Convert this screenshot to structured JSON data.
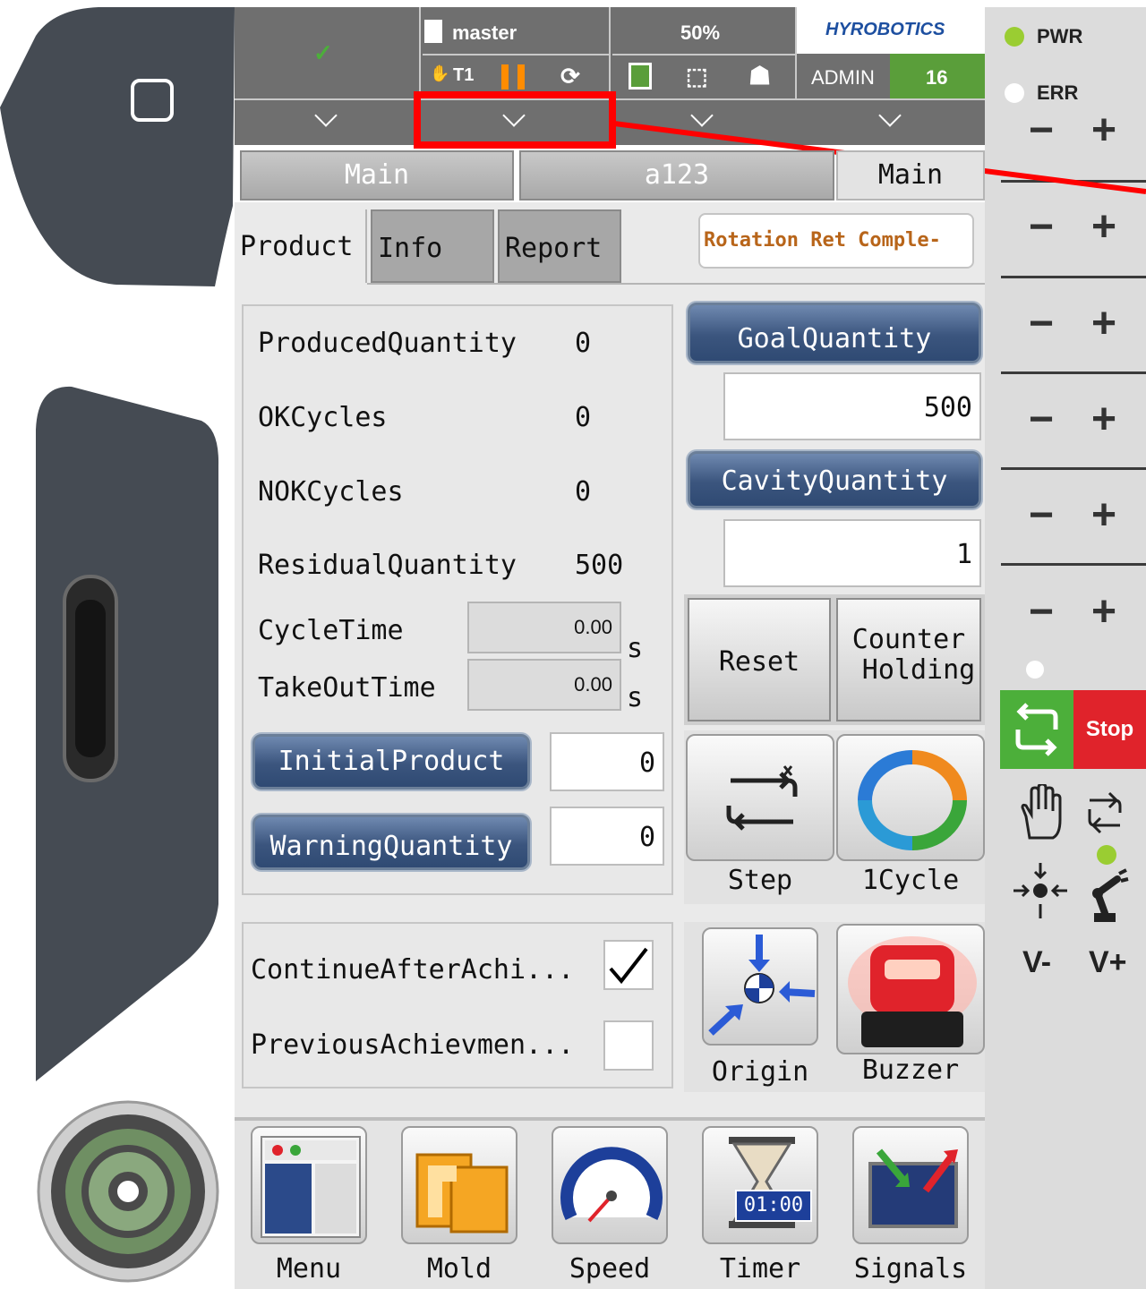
{
  "status_bar": {
    "check_symbol": "✓",
    "program_name": "master",
    "mode": "T1",
    "speed": "50%",
    "brand_logo": "HYROBOTICS",
    "user": "ADMIN",
    "user_level": "16"
  },
  "side_panel": {
    "pwr_label": "PWR",
    "err_label": "ERR",
    "stop_label": "Stop",
    "v_minus": "V-",
    "v_plus": "V+",
    "minus": "−",
    "plus": "+"
  },
  "nav_tabs": [
    "Main",
    "a123",
    "Main"
  ],
  "page_tabs": [
    "Product",
    "Info",
    "Report"
  ],
  "status_message": "Rotation Ret Comple-",
  "counters": [
    {
      "label": "ProducedQuantity",
      "value": "0"
    },
    {
      "label": "OKCycles",
      "value": "0"
    },
    {
      "label": "NOKCycles",
      "value": "0"
    },
    {
      "label": "ResidualQuantity",
      "value": "500"
    }
  ],
  "cycle_time": {
    "label": "CycleTime",
    "value": "0.00",
    "unit": "s"
  },
  "takeout_time": {
    "label": "TakeOutTime",
    "value": "0.00",
    "unit": "s"
  },
  "initial_product": {
    "label": "InitialProduct",
    "value": "0"
  },
  "warning_quantity": {
    "label": "WarningQuantity",
    "value": "0"
  },
  "goal_quantity": {
    "label": "GoalQuantity",
    "value": "500"
  },
  "cavity_quantity": {
    "label": "CavityQuantity",
    "value": "1"
  },
  "reset_label": "Reset",
  "counter_holding": {
    "line1": "Counter",
    "line2": "Holding"
  },
  "options": [
    {
      "label": "ContinueAfterAchi...",
      "checked": true
    },
    {
      "label": "PreviousAchievmen...",
      "checked": false
    }
  ],
  "actions": {
    "step": "Step",
    "cycle": "1Cycle",
    "origin": "Origin",
    "buzzer": "Buzzer"
  },
  "timer_display": "01:00",
  "bottom_menu": [
    "Menu",
    "Mold",
    "Speed",
    "Timer",
    "Signals"
  ],
  "colors": {
    "accent_blue": "#3b557e",
    "run_green": "#4caf3a",
    "stop_red": "#e0232b",
    "highlight_red": "#ff0000",
    "led_green": "#9acd32"
  }
}
